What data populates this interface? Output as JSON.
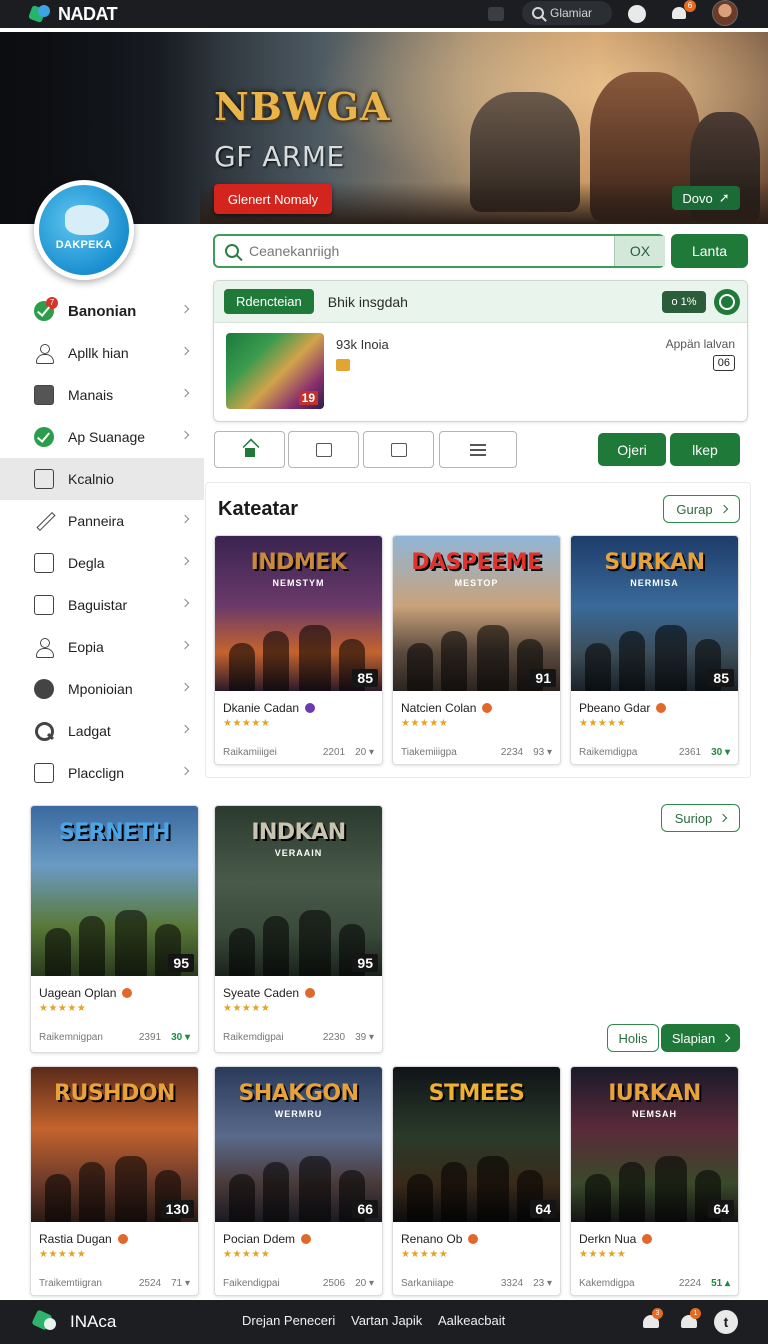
{
  "app": {
    "name": "NADAT"
  },
  "top_search": {
    "label": "Glamiar"
  },
  "top_notifications": {
    "badge": "6"
  },
  "hero": {
    "title": "NBWGA",
    "subtitle": "GF ARME",
    "cta_label": "Glenert Nomaly",
    "secondary_label": "Dovo"
  },
  "profile": {
    "badge_text": "DAKPEKA"
  },
  "sidebar": {
    "items": [
      {
        "label": "Banonian",
        "badge": "7"
      },
      {
        "label": "Apllk hian"
      },
      {
        "label": "Manais"
      },
      {
        "label": "Ap Suanage"
      },
      {
        "label": "Kcalnio"
      },
      {
        "label": "Panneira"
      },
      {
        "label": "Degla"
      },
      {
        "label": "Baguistar"
      },
      {
        "label": "Eopia"
      },
      {
        "label": "Mponioian"
      },
      {
        "label": "Ladgat"
      },
      {
        "label": "Placclign"
      }
    ]
  },
  "search": {
    "placeholder": "Ceanekanriigh",
    "ok_label": "OX",
    "submit_label": "Lanta"
  },
  "recommend": {
    "tag": "Rdencteian",
    "text": "Bhik insgdah",
    "pill": "o 1%",
    "item_name": "93k Inoia",
    "thumb_number": "19",
    "right_label": "Appän lalvan",
    "right_number": "06"
  },
  "actions": {
    "primary_a": "Ojeri",
    "primary_b": "lkep"
  },
  "section": {
    "title": "Kateatar",
    "btn_a": "Gurap",
    "btn_b": "Suriop",
    "btn_c": "Holis",
    "btn_d": "Slapian"
  },
  "cards": [
    {
      "art_title": "INDMEK",
      "art_sub": "NEMSTYM",
      "score": "85",
      "name": "Dkanie Cadan",
      "stars": "★★★★★",
      "footer_left": "Raikamiiigei",
      "footer_mid": "2201",
      "footer_right": "20 ▾"
    },
    {
      "art_title": "DASPEEME",
      "art_sub": "MESTOP",
      "score": "91",
      "name": "Natcien Colan",
      "stars": "★★★★★",
      "footer_left": "Tiakemiiigpa",
      "footer_mid": "2234",
      "footer_right": "93 ▾"
    },
    {
      "art_title": "SURKAN",
      "art_sub": "NERMISA",
      "score": "85",
      "name": "Pbeano Gdar",
      "stars": "★★★★★",
      "footer_left": "Raikemdigpa",
      "footer_mid": "2361",
      "footer_right": "30 ▾"
    },
    {
      "art_title": "SERNETH",
      "art_sub": "",
      "score": "95",
      "name": "Uagean Oplan",
      "stars": "★★★★★",
      "footer_left": "Raikemnigpan",
      "footer_mid": "2391",
      "footer_right": "30 ▾"
    },
    {
      "art_title": "INDKAN",
      "art_sub": "VERAAIN",
      "score": "95",
      "name": "Syeate Caden",
      "stars": "★★★★★",
      "footer_left": "Raikemdigpai",
      "footer_mid": "2230",
      "footer_right": "39 ▾"
    },
    {
      "art_title": "RUSHDON",
      "art_sub": "",
      "score": "130",
      "name": "Rastia Dugan",
      "stars": "★★★★★",
      "footer_left": "Traikemtiigran",
      "footer_mid": "2524",
      "footer_right": "71 ▾"
    },
    {
      "art_title": "SHAKGON",
      "art_sub": "WERMRU",
      "score": "66",
      "name": "Pocian Ddem",
      "stars": "★★★★★",
      "footer_left": "Faikendigpai",
      "footer_mid": "2506",
      "footer_right": "20 ▾"
    },
    {
      "art_title": "STMEES",
      "art_sub": "",
      "score": "64",
      "name": "Renano Ob",
      "stars": "★★★★★",
      "footer_left": "Sarkaniiape",
      "footer_mid": "3324",
      "footer_right": "23 ▾"
    },
    {
      "art_title": "IURKAN",
      "art_sub": "NEMSAH",
      "score": "64",
      "name": "Derkn Nua",
      "stars": "★★★★★",
      "footer_left": "Kakemdigpa",
      "footer_mid": "2224",
      "footer_right": "51 ▴"
    }
  ],
  "bottom": {
    "name": "INAca",
    "links": [
      "Drejan Peneceri",
      "Vartan Japik",
      "Aalkeacbait"
    ],
    "badge_a": "3",
    "badge_b": "1",
    "round_label": "t"
  },
  "colors": {
    "accent_green": "#1f7a3a",
    "hero_red": "#d3241e",
    "star_gold": "#e3a325",
    "badge_orange": "#e66a1f"
  }
}
